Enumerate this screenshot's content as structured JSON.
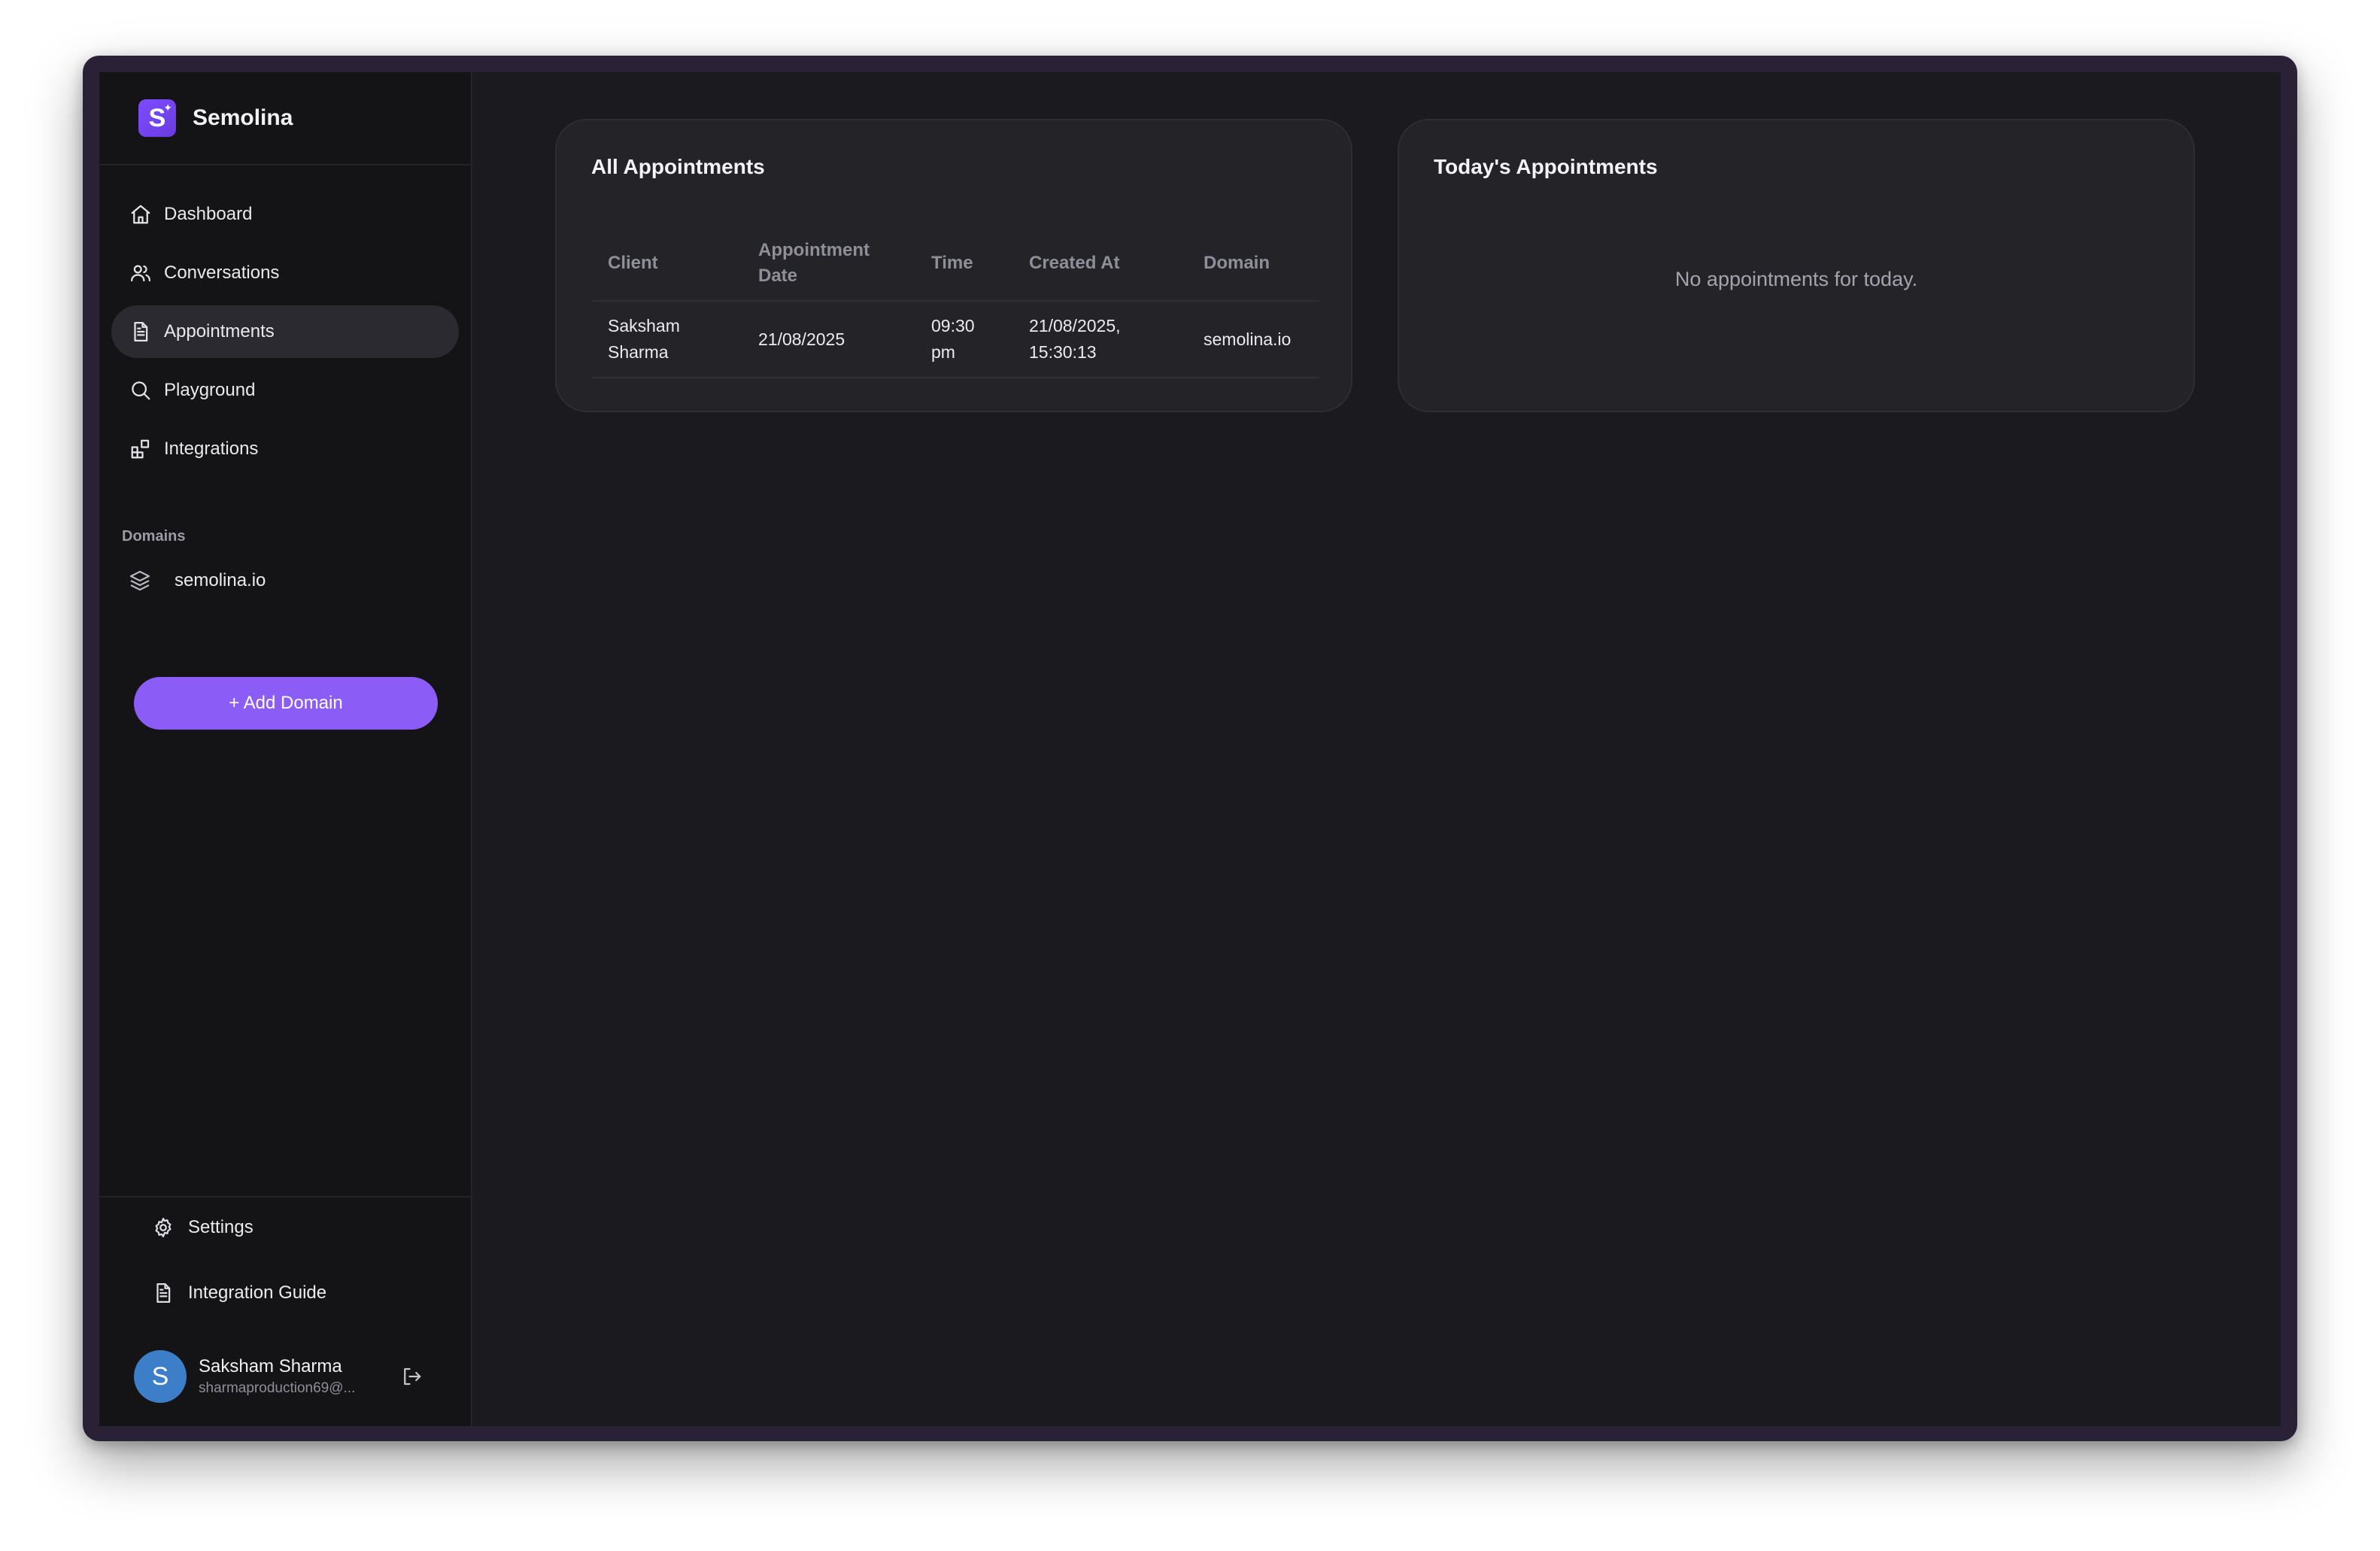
{
  "app": {
    "name": "Semolina",
    "logo_letter": "S"
  },
  "nav": [
    {
      "label": "Dashboard",
      "icon": "home-icon"
    },
    {
      "label": "Conversations",
      "icon": "users-icon"
    },
    {
      "label": "Appointments",
      "icon": "document-icon",
      "active": true
    },
    {
      "label": "Playground",
      "icon": "search-icon"
    },
    {
      "label": "Integrations",
      "icon": "integrations-icon"
    }
  ],
  "domains": {
    "title": "Domains",
    "items": [
      {
        "label": "semolina.io",
        "icon": "layers-icon"
      }
    ],
    "add_label": "+ Add Domain"
  },
  "bottom": {
    "settings_label": "Settings",
    "guide_label": "Integration Guide"
  },
  "user": {
    "initial": "S",
    "name": "Saksham Sharma",
    "email": "sharmaproduction69@..."
  },
  "all_appointments": {
    "title": "All Appointments",
    "columns": [
      "Client",
      "Appointment Date",
      "Time",
      "Created At",
      "Domain"
    ],
    "rows": [
      {
        "client": "Saksham Sharma",
        "date": "21/08/2025",
        "time": "09:30 pm",
        "created_at": "21/08/2025, 15:30:13",
        "domain": "semolina.io"
      }
    ]
  },
  "today_appointments": {
    "title": "Today's Appointments",
    "empty_text": "No appointments for today."
  },
  "colors": {
    "accent": "#8b5cf6",
    "background": "#1b1b1f",
    "sidebar": "#141417",
    "card": "#232328",
    "avatar": "#3d7ec9"
  }
}
